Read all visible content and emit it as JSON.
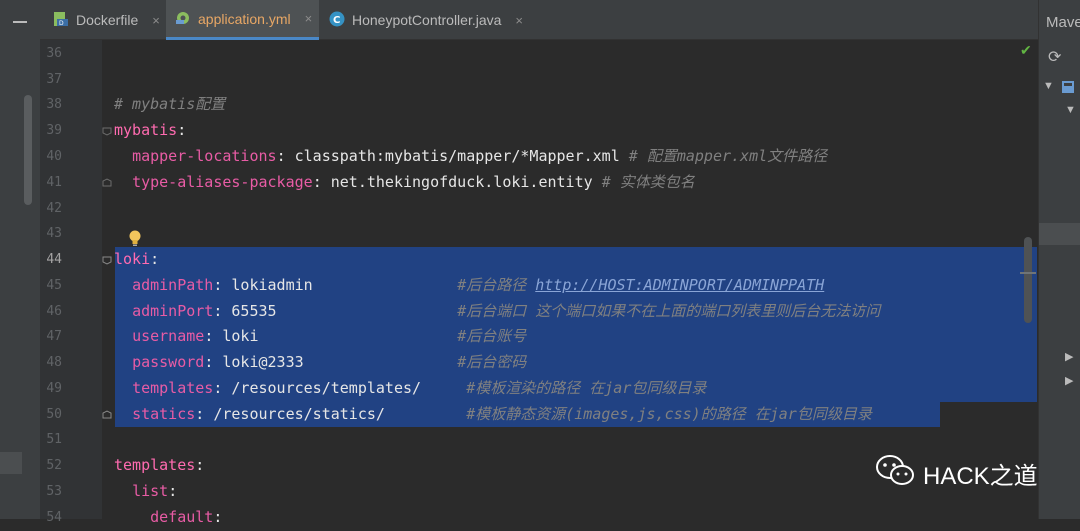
{
  "tabs": [
    {
      "label": "Dockerfile",
      "icon": "docker-file-icon",
      "active": false
    },
    {
      "label": "application.yml",
      "icon": "yaml-config-icon",
      "active": true
    },
    {
      "label": "HoneypotController.java",
      "icon": "java-class-icon",
      "active": false
    }
  ],
  "tab_close_glyph": "×",
  "right_panel": {
    "title": "Mave",
    "refresh_glyph": "⟳"
  },
  "watermark": {
    "text": "HACK之道"
  },
  "editor": {
    "current_line": "44",
    "lines": {
      "l36": {
        "num": "36"
      },
      "l37": {
        "num": "37"
      },
      "l38": {
        "num": "38",
        "comment": "# mybatis配置"
      },
      "l39": {
        "num": "39",
        "key": "mybatis",
        "colon": ":"
      },
      "l40": {
        "num": "40",
        "indent": "  ",
        "key": "mapper-locations",
        "colon": ": ",
        "value": "classpath:mybatis/mapper/*Mapper.xml ",
        "comment": "# 配置mapper.xml文件路径"
      },
      "l41": {
        "num": "41",
        "indent": "  ",
        "key": "type-aliases-package",
        "colon": ": ",
        "value": "net.thekingofduck.loki.entity ",
        "comment": "# 实体类包名"
      },
      "l42": {
        "num": "42"
      },
      "l43": {
        "num": "43"
      },
      "l44": {
        "num": "44",
        "key": "loki",
        "colon": ":"
      },
      "l45": {
        "num": "45",
        "indent": "  ",
        "key": "adminPath",
        "colon": ": ",
        "value": "lokiadmin                ",
        "comment": "#后台路径 ",
        "link": "http://HOST:ADMINPORT/ADMINPPATH"
      },
      "l46": {
        "num": "46",
        "indent": "  ",
        "key": "adminPort",
        "colon": ": ",
        "value": "65535                    ",
        "comment": "#后台端口 这个端口如果不在上面的端口列表里则后台无法访问"
      },
      "l47": {
        "num": "47",
        "indent": "  ",
        "key": "username",
        "colon": ": ",
        "value": "loki                      ",
        "comment": "#后台账号"
      },
      "l48": {
        "num": "48",
        "indent": "  ",
        "key": "password",
        "colon": ": ",
        "value": "loki@2333                 ",
        "comment": "#后台密码"
      },
      "l49": {
        "num": "49",
        "indent": "  ",
        "key": "templates",
        "colon": ": ",
        "value": "/resources/templates/     ",
        "comment": "#模板渲染的路径 在jar包同级目录"
      },
      "l50": {
        "num": "50",
        "indent": "  ",
        "key": "statics",
        "colon": ": ",
        "value": "/resources/statics/         ",
        "comment": "#模板静态资源(images,js,css)的路径 在jar包同级目录"
      },
      "l51": {
        "num": "51"
      },
      "l52": {
        "num": "52",
        "key": "templates",
        "colon": ":"
      },
      "l53": {
        "num": "53",
        "indent": "  ",
        "key": "list",
        "colon": ":"
      },
      "l54": {
        "num": "54",
        "indent": "    ",
        "key": "default",
        "colon": ":"
      }
    }
  },
  "colors": {
    "editor_bg": "#2b2b2b",
    "selection": "#214283",
    "key_top": "#ff6bb0",
    "key_nested": "#e85ca5",
    "comment": "#808080",
    "active_tab_text": "#e8a765"
  }
}
